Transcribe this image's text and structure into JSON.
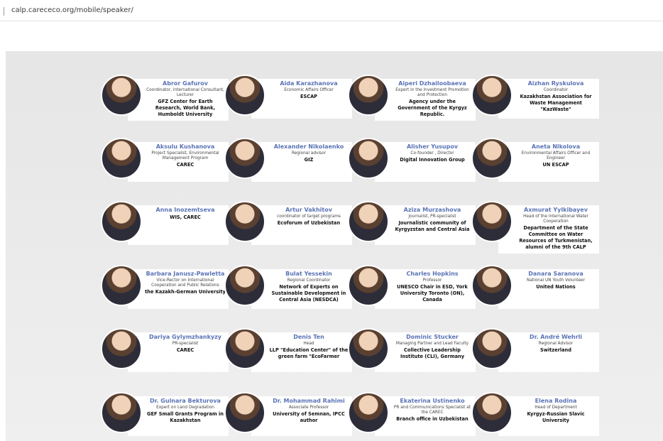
{
  "browser": {
    "url": "calp.carececo.org/mobile/speaker/"
  },
  "speakers": [
    {
      "name": "Abror Gafurov",
      "role": "Coordinator, International Consultant, Lecturer",
      "org": "GFZ Center for Earth Research, World Bank, Humboldt University"
    },
    {
      "name": "Aida Karazhanova",
      "role": "Economic Affairs Officer",
      "org": "ESCAP"
    },
    {
      "name": "Aiperi Dzhailoobaeva",
      "role": "Expert in the Investment Promotion and Protection",
      "org": "Agency under the Government of the Kyrgyz Republic."
    },
    {
      "name": "Aizhan Ryskulova",
      "role": "Coordinator",
      "org": "Kazakhstan Association for Waste Management \"KazWaste\""
    },
    {
      "name": "Aksulu Kushanova",
      "role": "Project Specialist, Environmental Management Program",
      "org": "CAREC"
    },
    {
      "name": "Alexander Nikolaenko",
      "role": "Regional advisor",
      "org": "GIZ"
    },
    {
      "name": "Alisher Yusupov",
      "role": "Co-founder , Director",
      "org": "Digital Innovation Group"
    },
    {
      "name": "Aneta Nikolova",
      "role": "Environmental Affairs Officer and Engineer",
      "org": "UN ESCAP"
    },
    {
      "name": "Anna Inozemtseva",
      "role": "",
      "org": "WIS, CAREC"
    },
    {
      "name": "Artur Vakhitov",
      "role": "coordinator of target programs",
      "org": "Ecoforum of Uzbekistan"
    },
    {
      "name": "Aziza Murzashova",
      "role": "Journalist, PR-specialist",
      "org": "Journalistic community of Kyrgyzstan and Central Asia"
    },
    {
      "name": "Axmurat Yylkibayev",
      "role": "Head of the International Water Cooperation",
      "org": "Department of the State Committee on Water Resources of Turkmenistan, alumni of the 9th CALP"
    },
    {
      "name": "Barbara Janusz-Pawletta",
      "role": "Vice-Rector on International Cooperation and Public Relations",
      "org": "the Kazakh-German University"
    },
    {
      "name": "Bulat Yessekin",
      "role": "Regional Coordinator",
      "org": "Network of Experts on Sustainable Development in Central Asia (NESDCA)"
    },
    {
      "name": "Charles Hopkins",
      "role": "Professor",
      "org": "UNESCO Chair in ESD, York University Toronto (ON), Canada"
    },
    {
      "name": "Danara Saranova",
      "role": "National UN Youth Volunteer",
      "org": "United Nations"
    },
    {
      "name": "Dariya Gylymzhankyzy",
      "role": "PR-specialist",
      "org": "CAREC"
    },
    {
      "name": "Denis Ten",
      "role": "Head",
      "org": "LLP \"Education Center\" of the green farm \"EcoFarmer"
    },
    {
      "name": "Dominic Stucker",
      "role": "Managing Partner and Lead Faculty",
      "org": "Collective Leadership Institute (CLI), Germany"
    },
    {
      "name": "Dr. André Wehrli",
      "role": "Regional Advisor",
      "org": "Switzerland"
    },
    {
      "name": "Dr. Gulnara Bekturova",
      "role": "Expert on Land Degradation",
      "org": "GEF Small Grants Program in Kazakhstan"
    },
    {
      "name": "Dr. Mohammad Rahimi",
      "role": "Associate Professor",
      "org": "University of Semnan, IPCC author"
    },
    {
      "name": "Ekaterina Ustinenko",
      "role": "PR and Communications Specialist at the CAREC",
      "org": "Branch office in Uzbekistan"
    },
    {
      "name": "Elena Rodina",
      "role": "Head of Department",
      "org": "Kyrgyz-Russian Slavic University"
    }
  ]
}
